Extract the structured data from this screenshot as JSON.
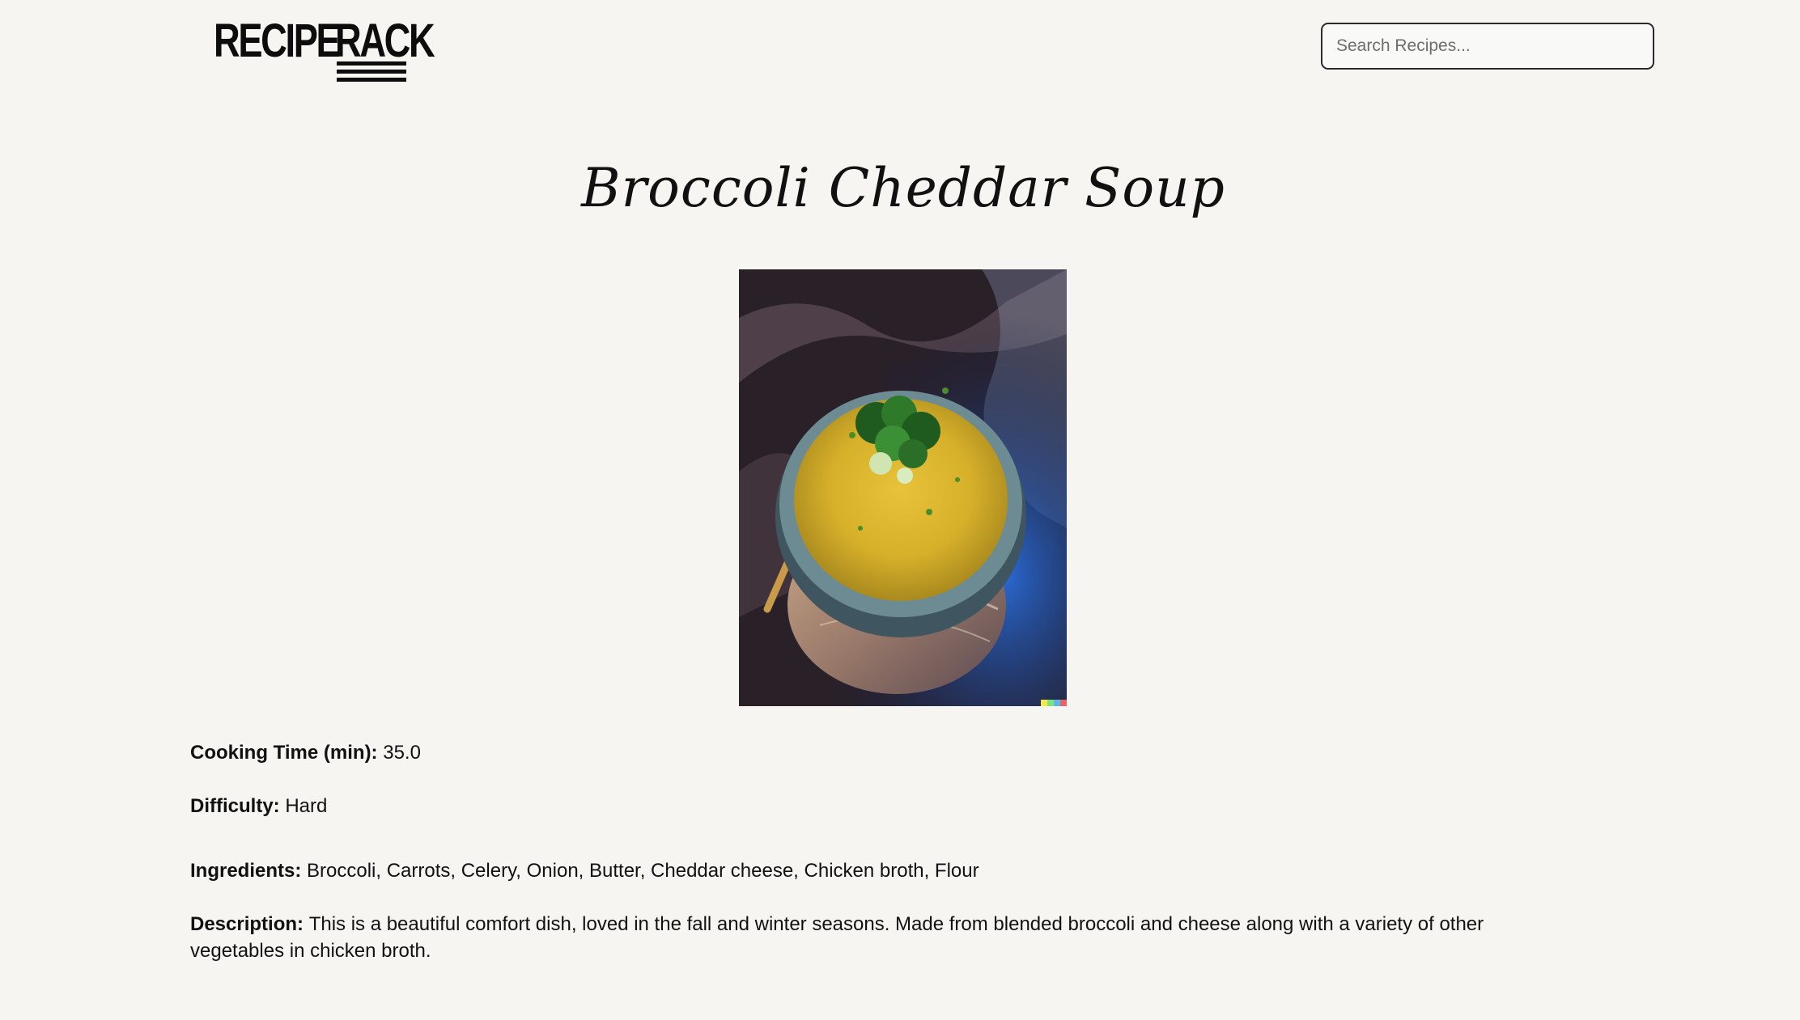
{
  "header": {
    "logo_word_1": "RECIPE",
    "logo_word_2": "RACK",
    "search_placeholder": "Search Recipes..."
  },
  "recipe": {
    "title": "Broccoli Cheddar Soup",
    "image_alt": "Bowl of broccoli cheddar soup",
    "cooking_time_label": "Cooking Time (min):",
    "cooking_time_value": "35.0",
    "difficulty_label": "Difficulty:",
    "difficulty_value": "Hard",
    "ingredients_label": "Ingredients:",
    "ingredients_value": "Broccoli, Carrots, Celery, Onion, Butter, Cheddar cheese, Chicken broth, Flour",
    "description_label": "Description:",
    "description_value": "This is a beautiful comfort dish, loved in the fall and winter seasons. Made from blended broccoli and cheese along with a variety of other vegetables in chicken broth."
  }
}
